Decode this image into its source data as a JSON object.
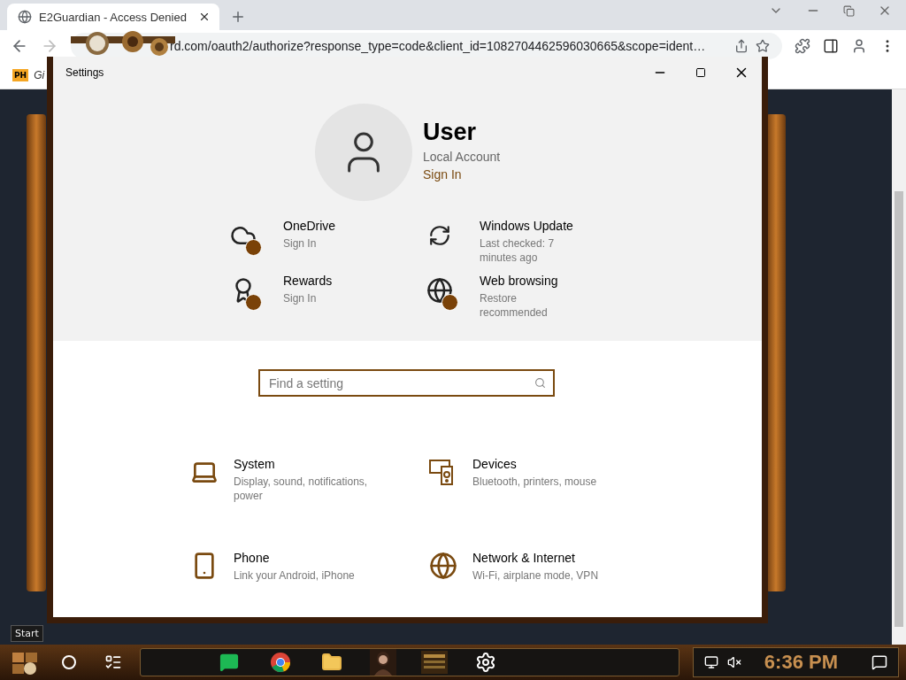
{
  "browser": {
    "tabs": [
      {
        "title": "E2Guardian - Access Denied",
        "selected": true
      }
    ],
    "address": "rd.com/oauth2/authorize?response_type=code&client_id=1082704462596030665&scope=ident…",
    "bookmarks": [
      {
        "icon_text": "PH",
        "label": "Gi"
      }
    ]
  },
  "settings": {
    "title": "Settings",
    "user": {
      "name": "User",
      "account": "Local Account",
      "link": "Sign In"
    },
    "status_items": [
      {
        "kind": "cloud",
        "title": "OneDrive",
        "detail": "Sign In",
        "badge": true
      },
      {
        "kind": "update",
        "title": "Windows Update",
        "detail": "Last checked: 7 minutes ago",
        "badge": false
      },
      {
        "kind": "rewards",
        "title": "Rewards",
        "detail": "Sign In",
        "badge": true
      },
      {
        "kind": "globe",
        "title": "Web browsing",
        "detail": "Restore recommended",
        "badge": true
      }
    ],
    "search": {
      "placeholder": "Find a setting"
    },
    "categories": [
      {
        "kind": "laptop",
        "title": "System",
        "detail": "Display, sound, notifications, power"
      },
      {
        "kind": "devices",
        "title": "Devices",
        "detail": "Bluetooth, printers, mouse"
      },
      {
        "kind": "phone",
        "title": "Phone",
        "detail": "Link your Android, iPhone"
      },
      {
        "kind": "globe",
        "title": "Network & Internet",
        "detail": "Wi-Fi, airplane mode, VPN"
      }
    ]
  },
  "start_tooltip": "Start",
  "taskbar": {
    "apps": [
      {
        "kind": "chat"
      },
      {
        "kind": "chrome"
      },
      {
        "kind": "folder"
      },
      {
        "kind": "portrait"
      },
      {
        "kind": "calendar"
      },
      {
        "kind": "gear"
      }
    ],
    "clock": "6:36 PM"
  }
}
